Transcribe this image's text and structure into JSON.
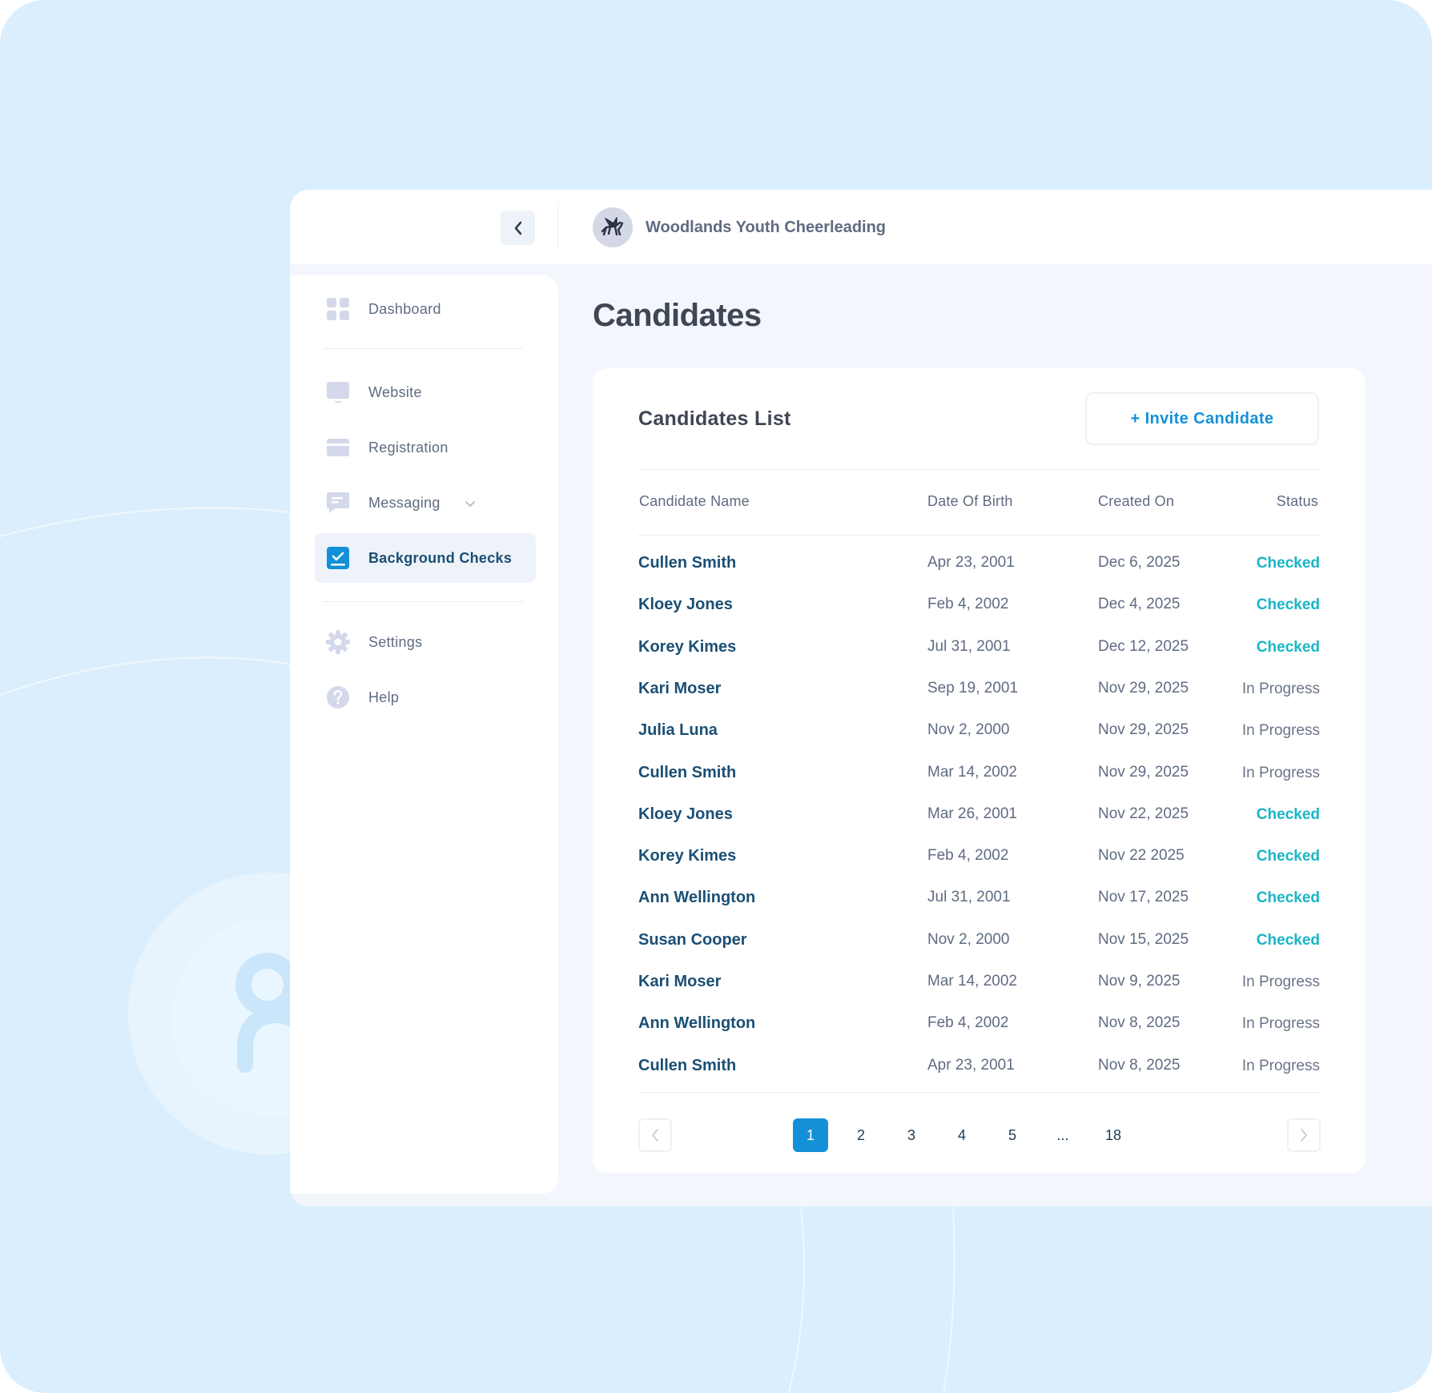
{
  "header": {
    "org_name": "Woodlands Youth Cheerleading",
    "org_logo_icon": "pegasus-logo-icon",
    "collapse_icon": "chevron-left-icon"
  },
  "sidebar": {
    "items": [
      {
        "id": "dashboard",
        "label": "Dashboard",
        "icon": "grid-icon"
      },
      {
        "id": "website",
        "label": "Website",
        "icon": "monitor-icon"
      },
      {
        "id": "registration",
        "label": "Registration",
        "icon": "card-icon"
      },
      {
        "id": "messaging",
        "label": "Messaging",
        "icon": "message-icon"
      },
      {
        "id": "background-checks",
        "label": "Background Checks",
        "icon": "check-box-icon",
        "active": true
      },
      {
        "id": "settings",
        "label": "Settings",
        "icon": "gear-icon"
      },
      {
        "id": "help",
        "label": "Help",
        "icon": "help-icon"
      }
    ]
  },
  "page": {
    "title": "Candidates"
  },
  "card": {
    "title": "Candidates List",
    "invite_label": "+ Invite Candidate",
    "columns": [
      "Candidate Name",
      "Date Of Birth",
      "Created On",
      "Status"
    ],
    "rows": [
      {
        "name": "Cullen Smith",
        "dob": "Apr 23, 2001",
        "created": "Dec 6, 2025",
        "status": "Checked"
      },
      {
        "name": "Kloey Jones",
        "dob": "Feb 4, 2002",
        "created": "Dec 4, 2025",
        "status": "Checked"
      },
      {
        "name": "Korey Kimes",
        "dob": "Jul 31, 2001",
        "created": "Dec 12, 2025",
        "status": "Checked"
      },
      {
        "name": "Kari Moser",
        "dob": "Sep 19, 2001",
        "created": "Nov 29, 2025",
        "status": "In Progress"
      },
      {
        "name": "Julia Luna",
        "dob": "Nov 2, 2000",
        "created": "Nov 29, 2025",
        "status": "In Progress"
      },
      {
        "name": "Cullen Smith",
        "dob": "Mar 14, 2002",
        "created": "Nov 29, 2025",
        "status": "In Progress"
      },
      {
        "name": "Kloey Jones",
        "dob": "Mar 26, 2001",
        "created": "Nov 22, 2025",
        "status": "Checked"
      },
      {
        "name": "Korey Kimes",
        "dob": "Feb 4, 2002",
        "created": "Nov 22 2025",
        "status": "Checked"
      },
      {
        "name": "Ann Wellington",
        "dob": "Jul 31, 2001",
        "created": "Nov 17, 2025",
        "status": "Checked"
      },
      {
        "name": "Susan Cooper",
        "dob": "Nov 2, 2000",
        "created": "Nov 15, 2025",
        "status": "Checked"
      },
      {
        "name": "Kari Moser",
        "dob": "Mar 14, 2002",
        "created": "Nov 9, 2025",
        "status": "In Progress"
      },
      {
        "name": "Ann Wellington",
        "dob": "Feb 4, 2002",
        "created": "Nov 8, 2025",
        "status": "In Progress"
      },
      {
        "name": "Cullen Smith",
        "dob": "Apr 23, 2001",
        "created": "Nov 8, 2025",
        "status": "In Progress"
      }
    ]
  },
  "pagination": {
    "pages": [
      "1",
      "2",
      "3",
      "4",
      "5",
      "...",
      "18"
    ],
    "current": "1"
  },
  "colors": {
    "accent": "#1490d8",
    "checked": "#18b6c6",
    "name_text": "#1b4f74",
    "background": "#daeefd"
  }
}
